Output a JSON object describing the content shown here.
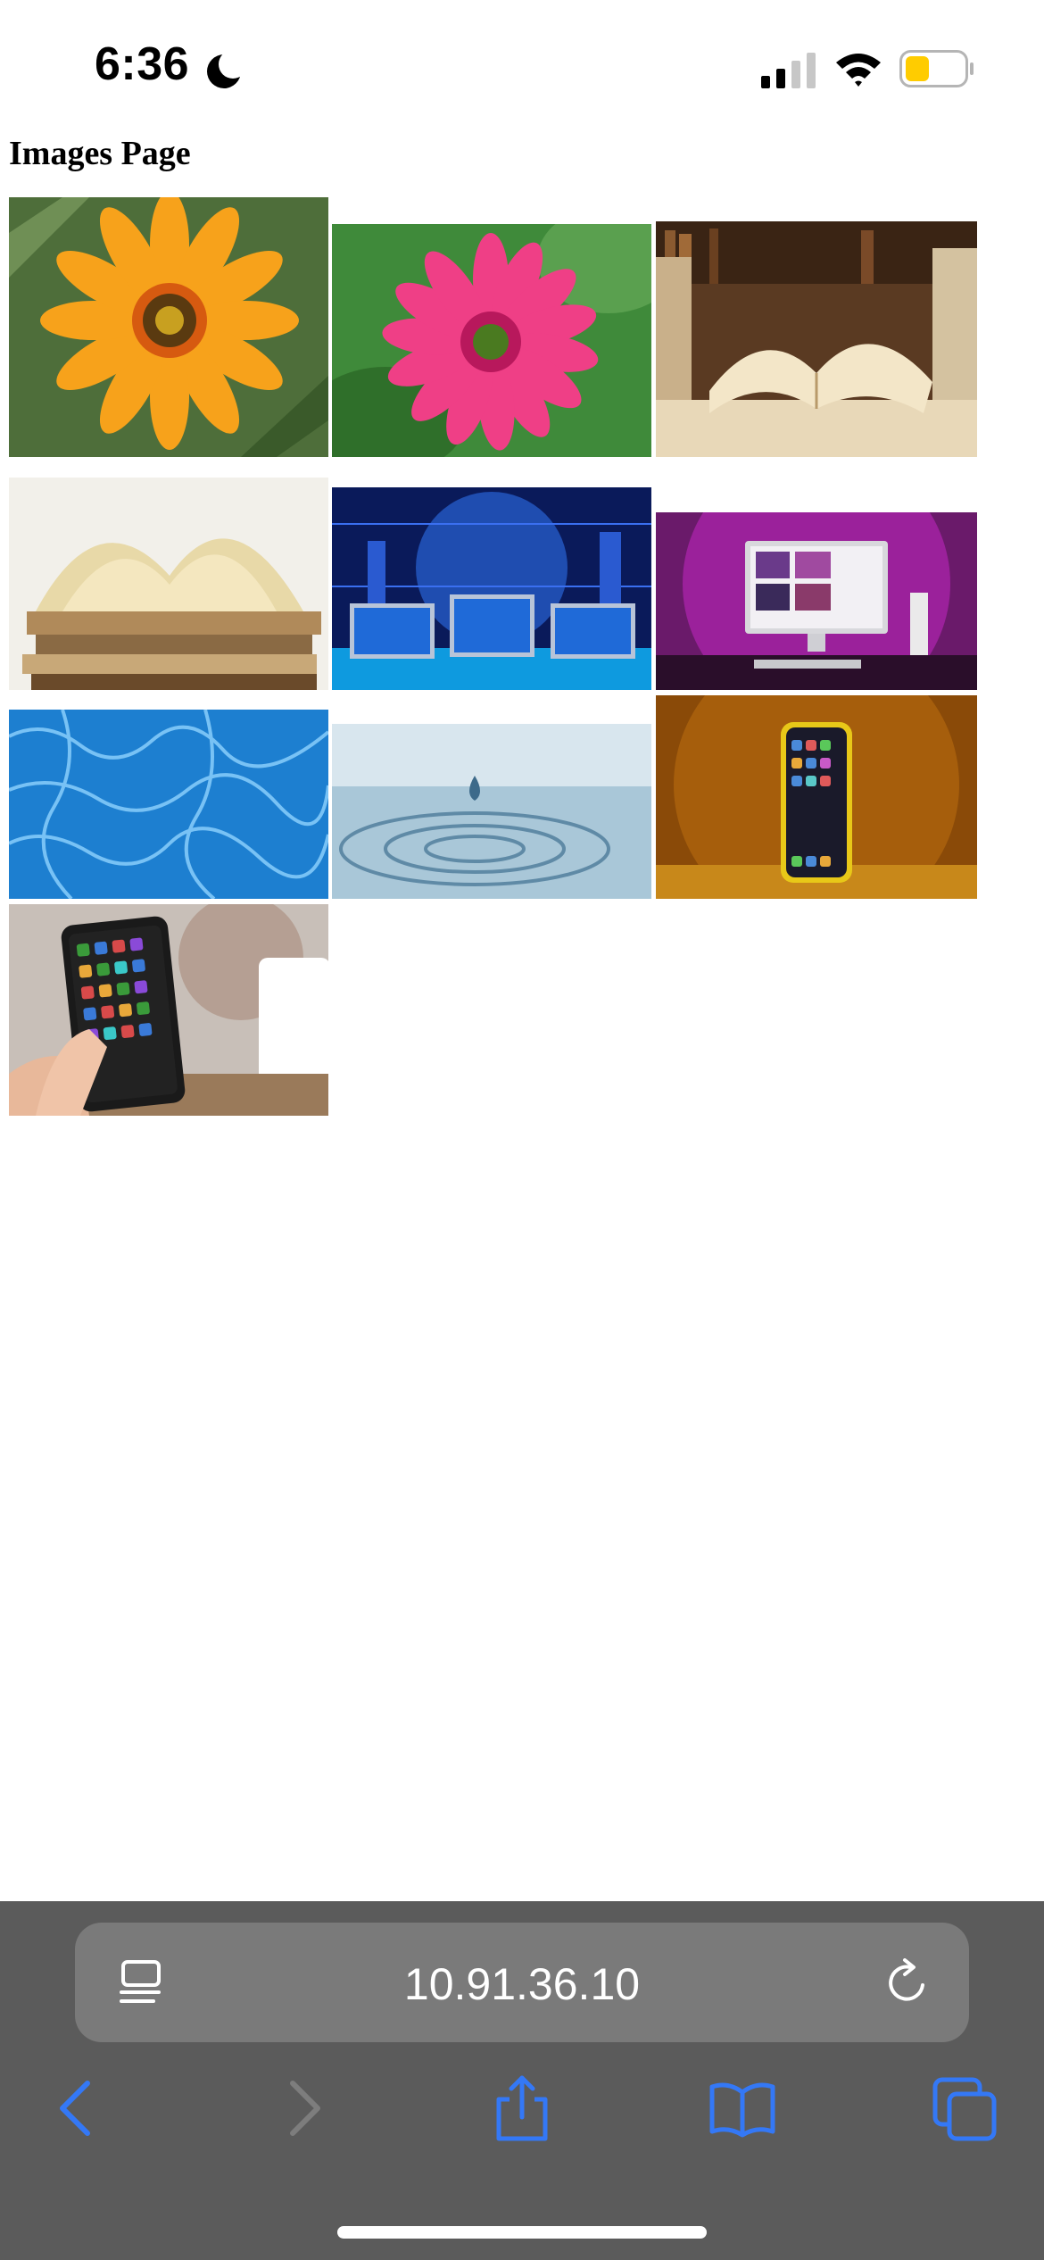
{
  "status_bar": {
    "time": "6:36",
    "icons": [
      "moon-icon",
      "cellular-signal-icon",
      "wifi-icon",
      "battery-icon"
    ],
    "battery_color": "#ffcc00",
    "battery_level": 0.4
  },
  "page": {
    "title": "Images Page",
    "images": [
      "orange-gazania-flower",
      "pink-gerbera-flower",
      "open-book-with-bookshelves",
      "open-book-on-stack",
      "computer-monitors-digital-city",
      "desktop-computer-pink-light",
      "blue-water-surface",
      "water-drop-ripple",
      "smartphone-on-orange-background",
      "hand-holding-smartphone"
    ]
  },
  "browser": {
    "address": "10.91.36.10",
    "accent_color": "#3478f6",
    "toolbar_color": "#5b5b5b",
    "icons": [
      "reader-icon",
      "reload-icon",
      "back-icon",
      "forward-icon",
      "share-icon",
      "bookmarks-icon",
      "tabs-icon"
    ]
  }
}
